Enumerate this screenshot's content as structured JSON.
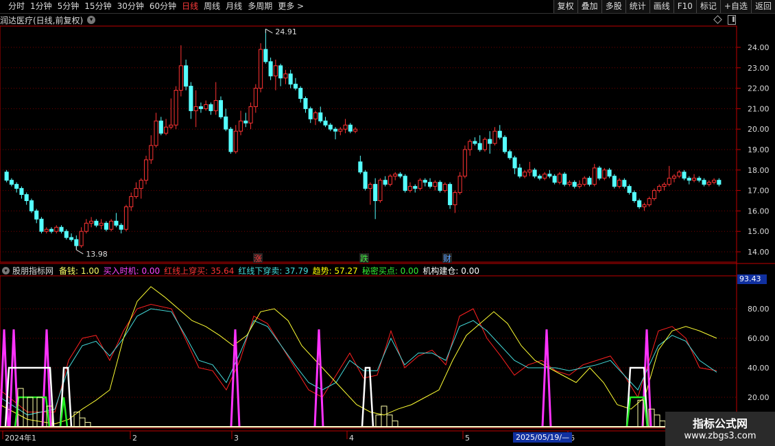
{
  "toolbar": {
    "periods": [
      "分时",
      "1分钟",
      "5分钟",
      "15分钟",
      "30分钟",
      "60分钟",
      "日线",
      "周线",
      "月线",
      "多周期",
      "更多 >"
    ],
    "active_period": "日线",
    "buttons": [
      "复权",
      "叠加",
      "多股",
      "统计",
      "画线",
      "F10",
      "标记",
      "+自选",
      "返回"
    ]
  },
  "chart_title": {
    "text": "润达医疗(日线,前复权)"
  },
  "price_axis": {
    "labels": [
      "24.00",
      "23.00",
      "22.00",
      "21.00",
      "20.00",
      "19.00",
      "18.00",
      "17.00",
      "16.00",
      "15.00",
      "14.00"
    ]
  },
  "price_annotations": {
    "high": "24.91",
    "low": "13.98"
  },
  "event_markers": {
    "rise": "涨",
    "fall": "跌",
    "finance": "财"
  },
  "indicator": {
    "name": "股朋指标网",
    "fields": [
      {
        "label": "备钱:",
        "value": "1.00",
        "color": "#ffff66"
      },
      {
        "label": "买入时机:",
        "value": "0.00",
        "color": "#ff44ff"
      },
      {
        "label": "红线上穿买:",
        "value": "35.64",
        "color": "#ff3333"
      },
      {
        "label": "红线下穿卖:",
        "value": "37.79",
        "color": "#44dddd"
      },
      {
        "label": "趋势:",
        "value": "57.27",
        "color": "#ffff00"
      },
      {
        "label": "秘密买点:",
        "value": "0.00",
        "color": "#33ee33"
      },
      {
        "label": "机构建仓:",
        "value": "0.00",
        "color": "#ffffff"
      }
    ],
    "axis_labels": [
      "80.00",
      "60.00",
      "40.00",
      "20.00"
    ],
    "current_value": "93.43"
  },
  "time_axis": {
    "labels": [
      "2024年1",
      "2",
      "3",
      "4",
      "5",
      "6"
    ],
    "cursor_date": "2025/05/19/—"
  },
  "watermark": {
    "title": "指标公式网",
    "url": "www.zbgs3.com"
  },
  "colors": {
    "up": "#ff3333",
    "down": "#55ffff",
    "grid": "#7a0000",
    "axis": "#c00000"
  },
  "candles": [
    [
      17.9,
      18.0,
      17.4,
      17.5
    ],
    [
      17.5,
      17.6,
      17.2,
      17.3
    ],
    [
      17.3,
      17.4,
      16.9,
      17.1
    ],
    [
      17.1,
      17.2,
      16.6,
      16.8
    ],
    [
      16.8,
      16.9,
      16.3,
      16.5
    ],
    [
      16.5,
      16.6,
      15.9,
      16.0
    ],
    [
      16.0,
      16.1,
      15.4,
      15.6
    ],
    [
      15.6,
      15.7,
      14.9,
      15.0
    ],
    [
      15.0,
      15.2,
      14.9,
      15.1
    ],
    [
      15.1,
      15.2,
      14.9,
      15.0
    ],
    [
      15.0,
      15.3,
      14.9,
      15.2
    ],
    [
      15.2,
      15.3,
      14.9,
      15.0
    ],
    [
      15.0,
      15.1,
      14.6,
      14.7
    ],
    [
      14.7,
      14.9,
      14.5,
      14.6
    ],
    [
      14.6,
      14.8,
      14.1,
      14.3
    ],
    [
      14.3,
      15.2,
      14.2,
      15.0
    ],
    [
      15.0,
      15.6,
      14.9,
      15.4
    ],
    [
      15.4,
      15.7,
      15.2,
      15.5
    ],
    [
      15.5,
      15.6,
      15.2,
      15.3
    ],
    [
      15.3,
      15.6,
      15.1,
      15.4
    ],
    [
      15.4,
      15.5,
      15.0,
      15.1
    ],
    [
      15.1,
      15.6,
      15.0,
      15.5
    ],
    [
      15.5,
      15.9,
      15.2,
      15.3
    ],
    [
      15.3,
      15.4,
      14.9,
      15.1
    ],
    [
      15.1,
      16.3,
      15.0,
      16.2
    ],
    [
      16.2,
      16.9,
      16.0,
      16.7
    ],
    [
      16.7,
      17.4,
      16.6,
      17.1
    ],
    [
      17.1,
      17.6,
      16.6,
      17.5
    ],
    [
      17.5,
      18.7,
      17.3,
      18.5
    ],
    [
      18.5,
      19.7,
      18.3,
      19.2
    ],
    [
      19.2,
      20.8,
      19.1,
      20.4
    ],
    [
      20.4,
      20.6,
      19.7,
      19.8
    ],
    [
      19.8,
      20.5,
      19.7,
      20.1
    ],
    [
      20.1,
      21.5,
      20.0,
      20.2
    ],
    [
      20.2,
      22.1,
      20.0,
      21.9
    ],
    [
      21.9,
      24.1,
      21.6,
      23.1
    ],
    [
      23.1,
      23.4,
      21.9,
      22.1
    ],
    [
      22.1,
      22.3,
      20.5,
      20.9
    ],
    [
      20.9,
      21.9,
      20.1,
      21.1
    ],
    [
      21.1,
      21.3,
      20.8,
      21.0
    ],
    [
      21.0,
      21.4,
      20.9,
      21.2
    ],
    [
      21.2,
      21.3,
      20.7,
      20.9
    ],
    [
      20.9,
      22.3,
      20.7,
      21.4
    ],
    [
      21.4,
      21.6,
      20.5,
      20.6
    ],
    [
      20.6,
      21.0,
      19.9,
      20.0
    ],
    [
      20.0,
      20.1,
      18.8,
      18.9
    ],
    [
      18.9,
      20.2,
      18.8,
      19.9
    ],
    [
      19.9,
      20.9,
      19.7,
      20.4
    ],
    [
      20.4,
      20.8,
      20.1,
      20.3
    ],
    [
      20.3,
      21.3,
      20.0,
      21.1
    ],
    [
      21.1,
      22.2,
      20.8,
      22.0
    ],
    [
      22.0,
      24.2,
      21.8,
      23.9
    ],
    [
      23.9,
      24.9,
      23.2,
      23.3
    ],
    [
      23.3,
      23.5,
      22.4,
      22.6
    ],
    [
      22.6,
      23.4,
      21.9,
      23.1
    ],
    [
      23.1,
      23.2,
      22.1,
      22.5
    ],
    [
      22.5,
      22.9,
      22.2,
      22.7
    ],
    [
      22.7,
      22.9,
      22.0,
      22.2
    ],
    [
      22.2,
      22.5,
      21.9,
      22.0
    ],
    [
      22.0,
      22.1,
      21.3,
      21.5
    ],
    [
      21.5,
      21.6,
      20.8,
      21.0
    ],
    [
      21.0,
      21.1,
      20.3,
      20.5
    ],
    [
      20.5,
      20.9,
      20.2,
      20.8
    ],
    [
      20.8,
      21.1,
      20.3,
      20.4
    ],
    [
      20.4,
      20.6,
      20.1,
      20.2
    ],
    [
      20.2,
      20.3,
      19.9,
      20.0
    ],
    [
      20.0,
      20.1,
      19.5,
      19.9
    ],
    [
      19.9,
      20.1,
      19.7,
      20.0
    ],
    [
      20.0,
      20.5,
      19.8,
      20.2
    ],
    [
      20.2,
      20.3,
      19.8,
      19.9
    ],
    [
      19.9,
      20.1,
      19.8,
      20.0
    ],
    [
      18.4,
      18.7,
      17.8,
      17.9
    ],
    [
      17.9,
      18.0,
      17.0,
      17.1
    ],
    [
      17.1,
      17.4,
      16.3,
      17.3
    ],
    [
      17.3,
      17.6,
      15.6,
      16.5
    ],
    [
      16.5,
      17.6,
      16.4,
      17.5
    ],
    [
      17.5,
      17.7,
      17.2,
      17.3
    ],
    [
      17.3,
      17.8,
      17.2,
      17.7
    ],
    [
      17.7,
      17.9,
      17.5,
      17.8
    ],
    [
      17.8,
      17.9,
      17.6,
      17.7
    ],
    [
      17.7,
      17.8,
      16.9,
      17.0
    ],
    [
      17.0,
      17.4,
      16.9,
      17.2
    ],
    [
      17.2,
      17.3,
      16.9,
      17.1
    ],
    [
      17.1,
      17.6,
      17.0,
      17.5
    ],
    [
      17.5,
      17.6,
      17.2,
      17.4
    ],
    [
      17.4,
      17.6,
      17.1,
      17.2
    ],
    [
      17.2,
      17.5,
      17.0,
      17.4
    ],
    [
      17.4,
      17.5,
      16.9,
      17.0
    ],
    [
      17.0,
      17.4,
      16.9,
      17.3
    ],
    [
      17.3,
      17.4,
      16.1,
      16.3
    ],
    [
      16.3,
      17.0,
      15.9,
      16.9
    ],
    [
      16.9,
      17.9,
      16.8,
      17.7
    ],
    [
      17.7,
      19.2,
      17.6,
      19.0
    ],
    [
      19.0,
      19.5,
      18.7,
      19.4
    ],
    [
      19.4,
      19.6,
      19.2,
      19.3
    ],
    [
      19.3,
      19.7,
      18.9,
      19.0
    ],
    [
      19.0,
      19.6,
      18.9,
      19.5
    ],
    [
      19.5,
      19.9,
      18.8,
      19.3
    ],
    [
      19.3,
      20.1,
      19.2,
      19.9
    ],
    [
      19.9,
      20.2,
      19.5,
      19.6
    ],
    [
      19.6,
      19.7,
      18.8,
      18.9
    ],
    [
      18.9,
      19.0,
      18.5,
      18.6
    ],
    [
      18.6,
      18.7,
      17.8,
      18.1
    ],
    [
      18.1,
      18.3,
      17.6,
      17.7
    ],
    [
      17.7,
      18.0,
      17.6,
      17.9
    ],
    [
      17.9,
      18.4,
      17.7,
      18.0
    ],
    [
      18.0,
      18.1,
      17.6,
      17.7
    ],
    [
      17.7,
      17.8,
      17.5,
      17.6
    ],
    [
      17.6,
      17.9,
      17.5,
      17.8
    ],
    [
      17.8,
      18.0,
      17.6,
      17.7
    ],
    [
      17.7,
      17.8,
      17.3,
      17.4
    ],
    [
      17.4,
      17.9,
      17.3,
      17.8
    ],
    [
      17.8,
      17.9,
      17.2,
      17.3
    ],
    [
      17.3,
      17.5,
      17.2,
      17.4
    ],
    [
      17.4,
      17.5,
      17.1,
      17.2
    ],
    [
      17.2,
      17.5,
      17.1,
      17.3
    ],
    [
      17.3,
      17.7,
      17.2,
      17.6
    ],
    [
      17.6,
      17.7,
      17.2,
      17.3
    ],
    [
      17.3,
      18.3,
      17.2,
      18.1
    ],
    [
      18.1,
      18.2,
      17.5,
      17.6
    ],
    [
      17.6,
      18.1,
      17.5,
      18.0
    ],
    [
      18.0,
      18.1,
      17.6,
      17.7
    ],
    [
      17.7,
      17.8,
      17.1,
      17.2
    ],
    [
      17.2,
      17.6,
      17.1,
      17.5
    ],
    [
      17.5,
      17.6,
      17.1,
      17.2
    ],
    [
      17.2,
      17.3,
      16.8,
      16.9
    ],
    [
      16.9,
      17.0,
      16.4,
      16.5
    ],
    [
      16.5,
      16.6,
      16.1,
      16.2
    ],
    [
      16.2,
      16.4,
      16.0,
      16.3
    ],
    [
      16.3,
      16.7,
      16.2,
      16.6
    ],
    [
      16.6,
      17.1,
      16.5,
      17.0
    ],
    [
      17.0,
      17.3,
      16.9,
      17.2
    ],
    [
      17.2,
      17.4,
      17.0,
      17.3
    ],
    [
      17.3,
      18.2,
      17.2,
      17.6
    ],
    [
      17.6,
      17.8,
      17.4,
      17.7
    ],
    [
      17.7,
      18.0,
      17.6,
      17.9
    ],
    [
      17.9,
      18.0,
      17.5,
      17.6
    ],
    [
      17.6,
      17.7,
      17.3,
      17.5
    ],
    [
      17.5,
      17.8,
      17.4,
      17.6
    ],
    [
      17.6,
      17.7,
      17.4,
      17.5
    ],
    [
      17.5,
      17.6,
      17.2,
      17.3
    ],
    [
      17.3,
      17.5,
      17.2,
      17.4
    ],
    [
      17.4,
      17.6,
      17.3,
      17.5
    ],
    [
      17.5,
      17.6,
      17.2,
      17.3
    ]
  ]
}
